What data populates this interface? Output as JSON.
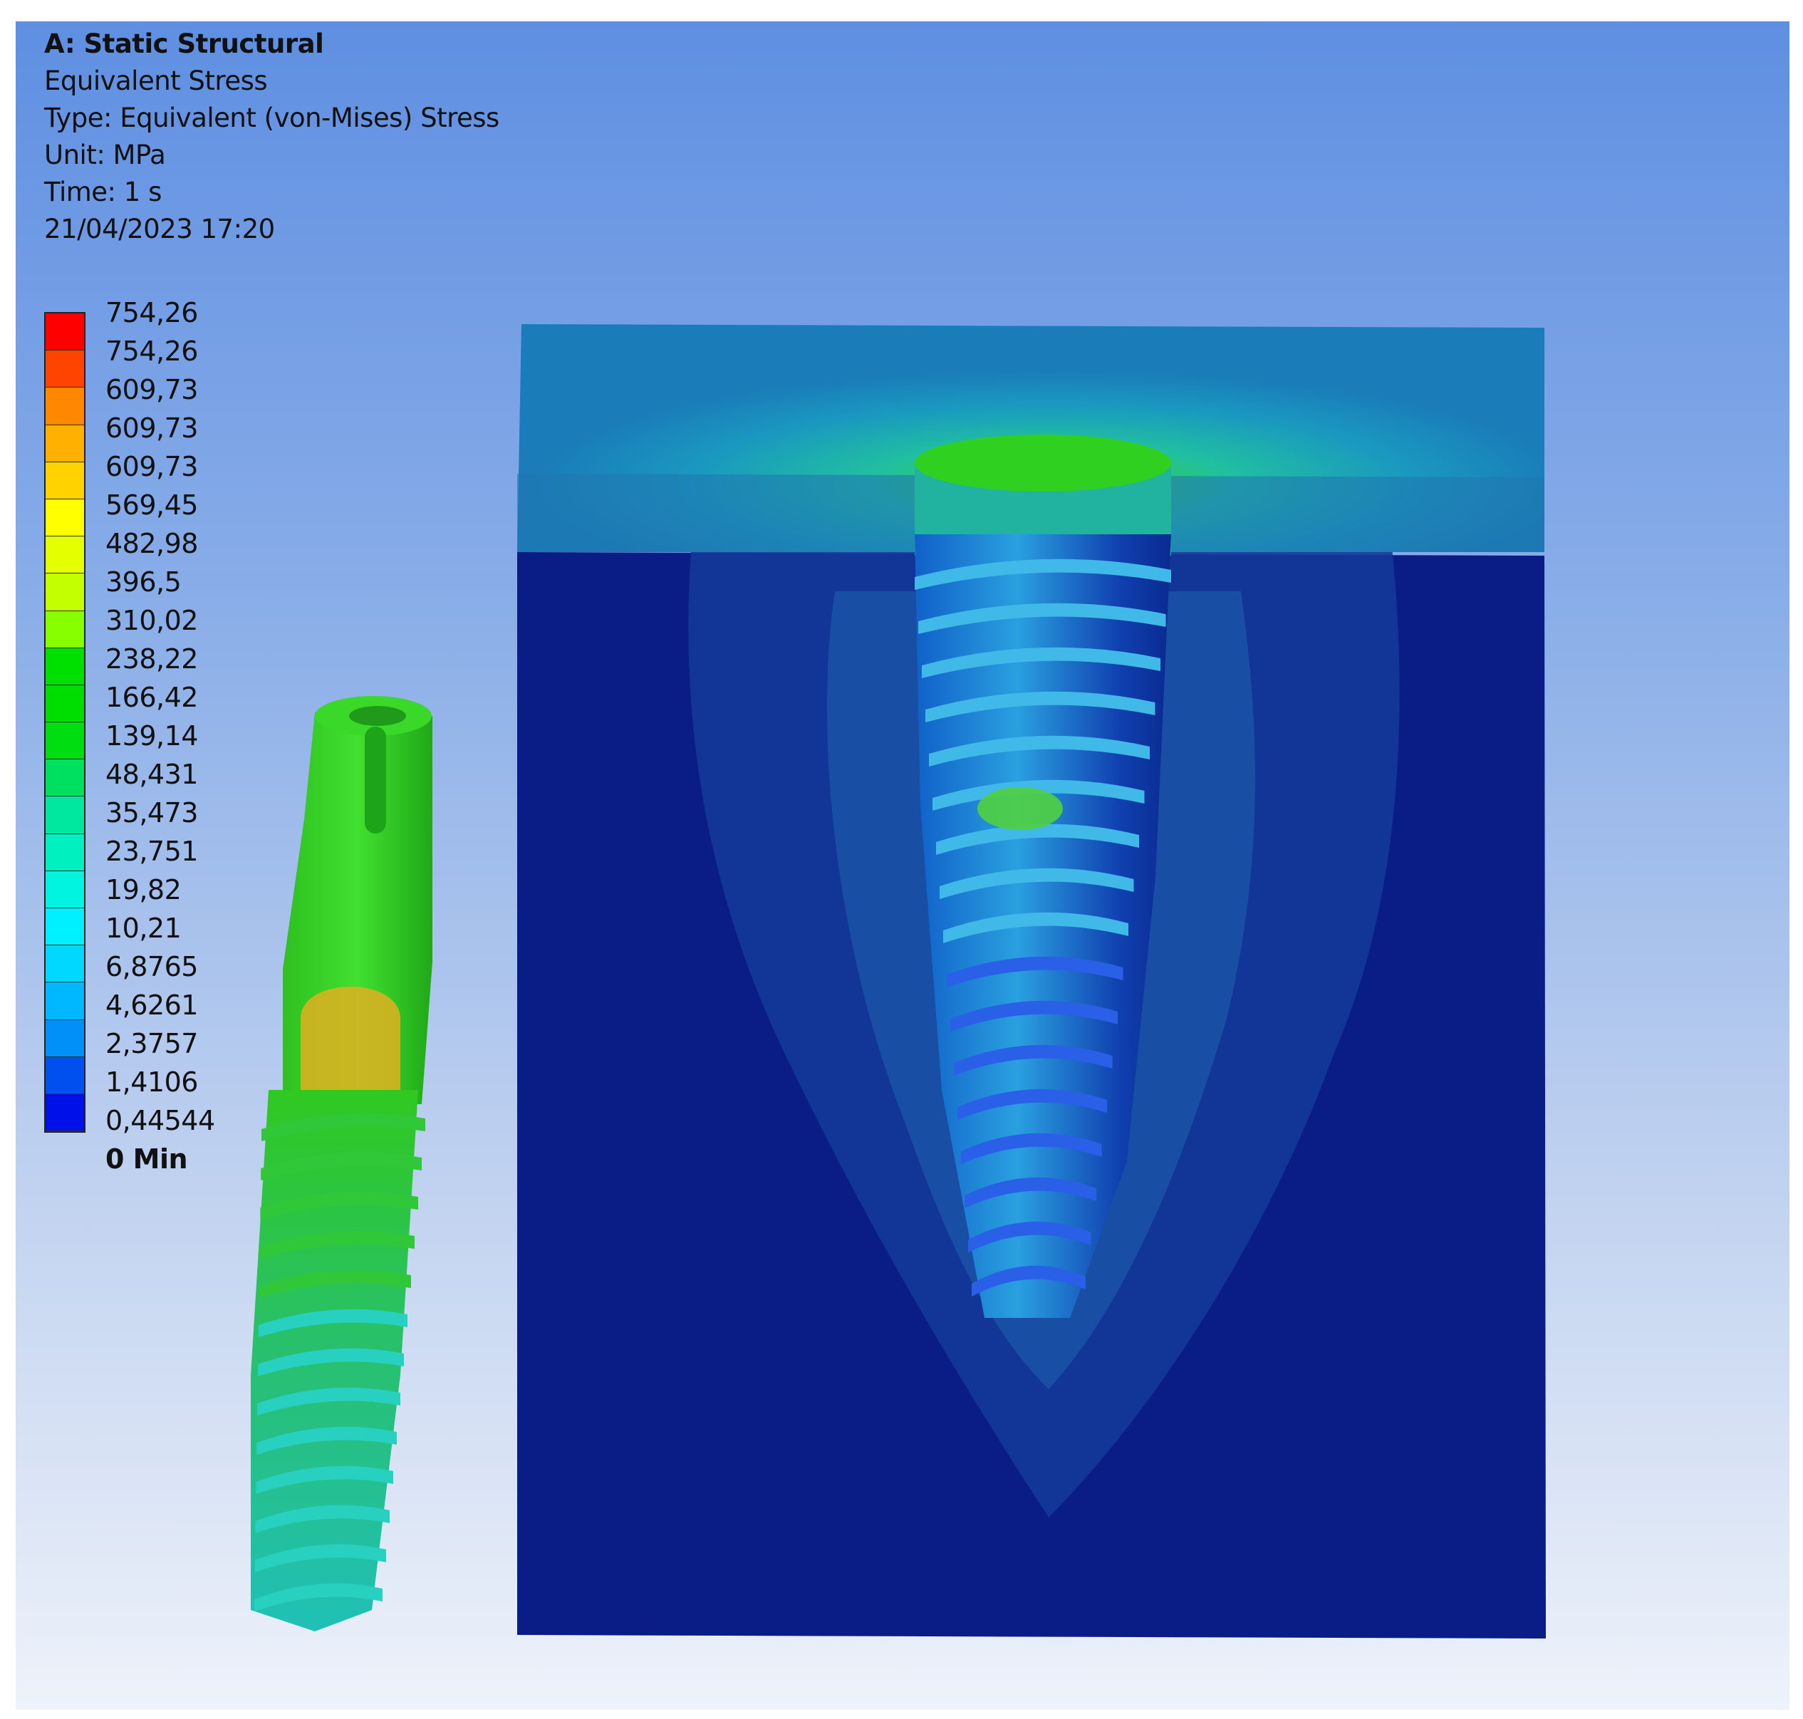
{
  "header": {
    "title": "A: Static Structural",
    "result": "Equivalent Stress",
    "type": "Type: Equivalent (von-Mises) Stress",
    "unit": "Unit: MPa",
    "time": "Time: 1 s",
    "timestamp": "21/04/2023 17:20"
  },
  "legend": {
    "labels": [
      "754,26",
      "754,26",
      "609,73",
      "609,73",
      "609,73",
      "569,45",
      "482,98",
      "396,5",
      "310,02",
      "238,22",
      "166,42",
      "139,14",
      "48,431",
      "35,473",
      "23,751",
      "19,82",
      "10,21",
      "6,8765",
      "4,6261",
      "2,3757",
      "1,4106",
      "0,44544",
      "0 Min"
    ],
    "colors": [
      "#ff0000",
      "#ff4400",
      "#ff8800",
      "#ffb000",
      "#ffd200",
      "#ffff00",
      "#e4ff00",
      "#c4ff00",
      "#88ff00",
      "#00e000",
      "#00dd00",
      "#00dd10",
      "#00e060",
      "#00e8a0",
      "#00f0c0",
      "#00f4e0",
      "#00f0ff",
      "#00d8ff",
      "#00b8ff",
      "#0090f8",
      "#0050f0",
      "#0010e8"
    ]
  },
  "colors": {
    "bone": "#0a1c86",
    "bone_halo": "#15409a",
    "plate": "#1d8eb8",
    "implant_green": "#22d41a",
    "thread_teal": "#20c8b8"
  }
}
